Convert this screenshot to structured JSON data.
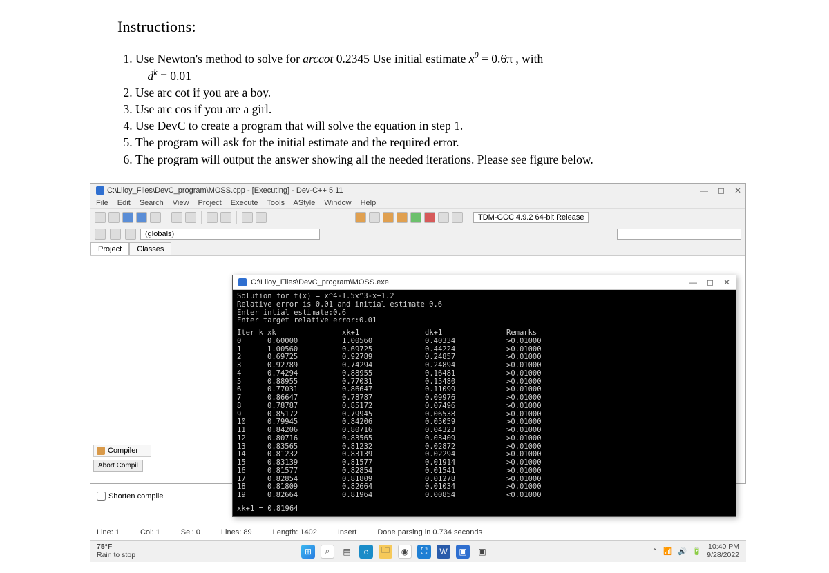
{
  "instructions": {
    "heading": "Instructions:",
    "item1_pre": "Use Newton's method to solve for ",
    "item1_arccot": "arccot",
    "item1_val": "0.2345",
    "item1_mid": "Use initial estimate ",
    "item1_x0": "x",
    "item1_eq": " = 0.6π , with",
    "item1_line2a": "d",
    "item1_line2b": " = 0.01",
    "item2": "Use arc cot if you are a boy.",
    "item3": "Use arc cos if you are a girl.",
    "item4": "Use DevC to create a program that will solve the equation in step 1.",
    "item5": "The program will ask for the initial estimate and the required error.",
    "item6": "The program will output the answer showing all the needed iterations. Please see figure below."
  },
  "devc": {
    "title": "C:\\Liloy_Files\\DevC_program\\MOSS.cpp - [Executing] - Dev-C++ 5.11",
    "menu": [
      "File",
      "Edit",
      "Search",
      "View",
      "Project",
      "Execute",
      "Tools",
      "AStyle",
      "Window",
      "Help"
    ],
    "compiler_combo": "TDM-GCC 4.9.2 64-bit Release",
    "globals": "(globals)",
    "tabs": [
      "Project",
      "Classes"
    ]
  },
  "console": {
    "title": "C:\\Liloy_Files\\DevC_program\\MOSS.exe",
    "l1": "Solution for f(x) = x^4-1.5x^3-x+1.2",
    "l2": "Relative error is 0.01 and initial estimate 0.6",
    "l3": "Enter intial estimate:0.6",
    "l4": "Enter target relative error:0.01",
    "hdr": [
      "Iter k",
      "xk",
      "xk+1",
      "dk+1",
      "Remarks"
    ],
    "rows": [
      [
        "0",
        "0.60000",
        "1.00560",
        "0.40334",
        ">0.01000"
      ],
      [
        "1",
        "1.00560",
        "0.69725",
        "0.44224",
        ">0.01000"
      ],
      [
        "2",
        "0.69725",
        "0.92789",
        "0.24857",
        ">0.01000"
      ],
      [
        "3",
        "0.92789",
        "0.74294",
        "0.24894",
        ">0.01000"
      ],
      [
        "4",
        "0.74294",
        "0.88955",
        "0.16481",
        ">0.01000"
      ],
      [
        "5",
        "0.88955",
        "0.77031",
        "0.15480",
        ">0.01000"
      ],
      [
        "6",
        "0.77031",
        "0.86647",
        "0.11099",
        ">0.01000"
      ],
      [
        "7",
        "0.86647",
        "0.78787",
        "0.09976",
        ">0.01000"
      ],
      [
        "8",
        "0.78787",
        "0.85172",
        "0.07496",
        ">0.01000"
      ],
      [
        "9",
        "0.85172",
        "0.79945",
        "0.06538",
        ">0.01000"
      ],
      [
        "10",
        "0.79945",
        "0.84206",
        "0.05059",
        ">0.01000"
      ],
      [
        "11",
        "0.84206",
        "0.80716",
        "0.04323",
        ">0.01000"
      ],
      [
        "12",
        "0.80716",
        "0.83565",
        "0.03409",
        ">0.01000"
      ],
      [
        "13",
        "0.83565",
        "0.81232",
        "0.02872",
        ">0.01000"
      ],
      [
        "14",
        "0.81232",
        "0.83139",
        "0.02294",
        ">0.01000"
      ],
      [
        "15",
        "0.83139",
        "0.81577",
        "0.01914",
        ">0.01000"
      ],
      [
        "16",
        "0.81577",
        "0.82854",
        "0.01541",
        ">0.01000"
      ],
      [
        "17",
        "0.82854",
        "0.81809",
        "0.01278",
        ">0.01000"
      ],
      [
        "18",
        "0.81809",
        "0.82664",
        "0.01034",
        ">0.01000"
      ],
      [
        "19",
        "0.82664",
        "0.81964",
        "0.00854",
        "<0.01000"
      ]
    ],
    "result": "xk+1 = 0.81964"
  },
  "leftpanel": {
    "compiler_tab": "Compiler",
    "abort": "Abort Compil",
    "shorten": "Shorten compile"
  },
  "statusbar": {
    "line": "Line:   1",
    "col": "Col:   1",
    "sel": "Sel:   0",
    "lines": "Lines:   89",
    "length": "Length:   1402",
    "insert": "Insert",
    "done": "Done parsing in 0.734 seconds"
  },
  "taskbar": {
    "temp": "75°F",
    "rain": "Rain to stop",
    "time": "10:40 PM",
    "date": "9/28/2022"
  }
}
